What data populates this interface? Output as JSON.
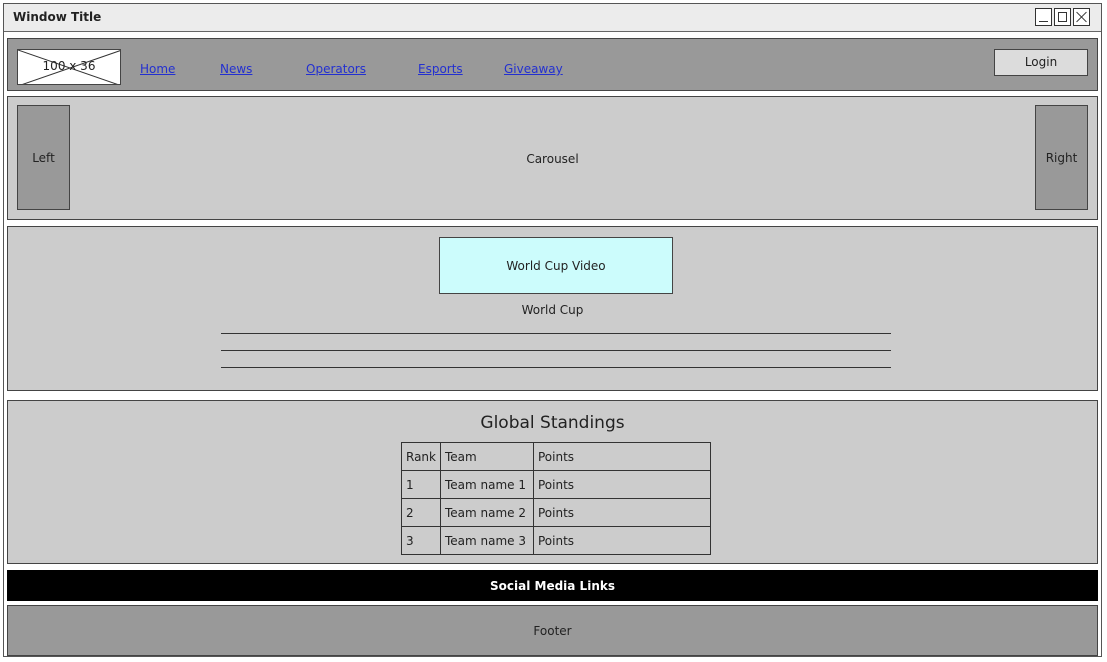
{
  "window": {
    "title": "Window Title"
  },
  "navbar": {
    "logo_placeholder": "100 x 36",
    "links": [
      "Home",
      "News",
      "Operators",
      "Esports",
      "Giveaway"
    ],
    "login_label": "Login"
  },
  "carousel": {
    "left_label": "Left",
    "label": "Carousel",
    "right_label": "Right"
  },
  "world_cup": {
    "video_label": "World Cup Video",
    "caption": "World Cup"
  },
  "standings": {
    "title": "Global Standings",
    "columns": [
      "Rank",
      "Team",
      "Points"
    ],
    "rows": [
      [
        "1",
        "Team name 1",
        "Points"
      ],
      [
        "2",
        "Team name 2",
        "Points"
      ],
      [
        "3",
        "Team name 3",
        "Points"
      ]
    ]
  },
  "social": {
    "label": "Social Media Links"
  },
  "footer": {
    "label": "Footer"
  },
  "colors": {
    "panel_gray": "#cccccc",
    "nav_gray": "#999999",
    "video_fill": "#ccfcfc",
    "link_blue": "#2330d0",
    "social_bar": "#000000"
  }
}
